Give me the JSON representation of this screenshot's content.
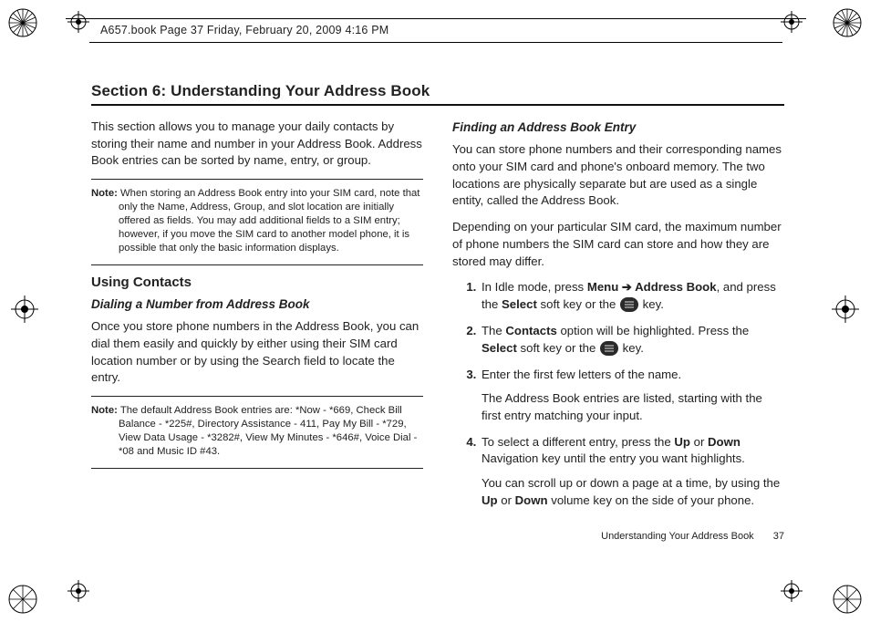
{
  "header": {
    "text": "A657.book  Page 37  Friday, February 20, 2009  4:16 PM"
  },
  "title": "Section 6: Understanding Your Address Book",
  "intro": "This section allows you to manage your daily contacts by storing their name and number in your Address Book. Address Book entries can be sorted by name, entry, or group.",
  "note1_label": "Note:",
  "note1": "When storing an Address Book entry into your SIM card, note that only the Name, Address, Group, and slot location are initially offered as fields. You may add additional fields to a SIM entry; however, if you move the SIM card to another model phone, it is possible that only the basic information displays.",
  "using": "Using Contacts",
  "dialhdr": "Dialing a Number from Address Book",
  "dialpara": "Once you store phone numbers in the Address Book, you can dial them easily and quickly by either using their SIM card location number or by using the Search field to locate the entry.",
  "note2_label": "Note:",
  "note2": "The default Address Book entries are: *Now - *669, Check Bill Balance - *225#, Directory Assistance - 411, Pay My Bill - *729, View Data Usage - *3282#, View My Minutes - *646#, Voice Dial - *08 and Music ID #43.",
  "findhdr": "Finding an Address Book Entry",
  "findp1": "You can store phone numbers and their corresponding names onto your SIM card and phone's onboard memory. The two locations are physically separate but are used as a single entity, called the Address Book.",
  "findp2": "Depending on your particular SIM card, the maximum number of phone numbers the SIM card can store and how they are stored may differ.",
  "steps": {
    "s1a": "In Idle mode, press ",
    "s1_menu": "Menu",
    "s1_arrow": " ➔ ",
    "s1_book": "Address Book",
    "s1b": ", and press the ",
    "s1_select": "Select",
    "s1c": " soft key or the ",
    "s1d": " key.",
    "s2a": " The ",
    "s2_contacts": "Contacts",
    "s2b": " option will be highlighted. Press the ",
    "s2_select": "Select",
    "s2c": " soft key or the ",
    "s2d": " key.",
    "s3": "Enter the first few letters of the name.",
    "s3b": "The Address Book entries are listed, starting with the first entry matching your input.",
    "s4a": "To select a different entry, press the ",
    "s4_up": "Up",
    "s4b": " or ",
    "s4_down": "Down",
    "s4c": " Navigation key until the entry you want highlights.",
    "s4d1": "You can scroll up or down a page at a time, by using the ",
    "s4d_up": "Up",
    "s4d2": " or ",
    "s4d_down": "Down",
    "s4d3": " volume key on the side of your phone."
  },
  "footer": {
    "label": "Understanding Your Address Book",
    "num": "37"
  }
}
